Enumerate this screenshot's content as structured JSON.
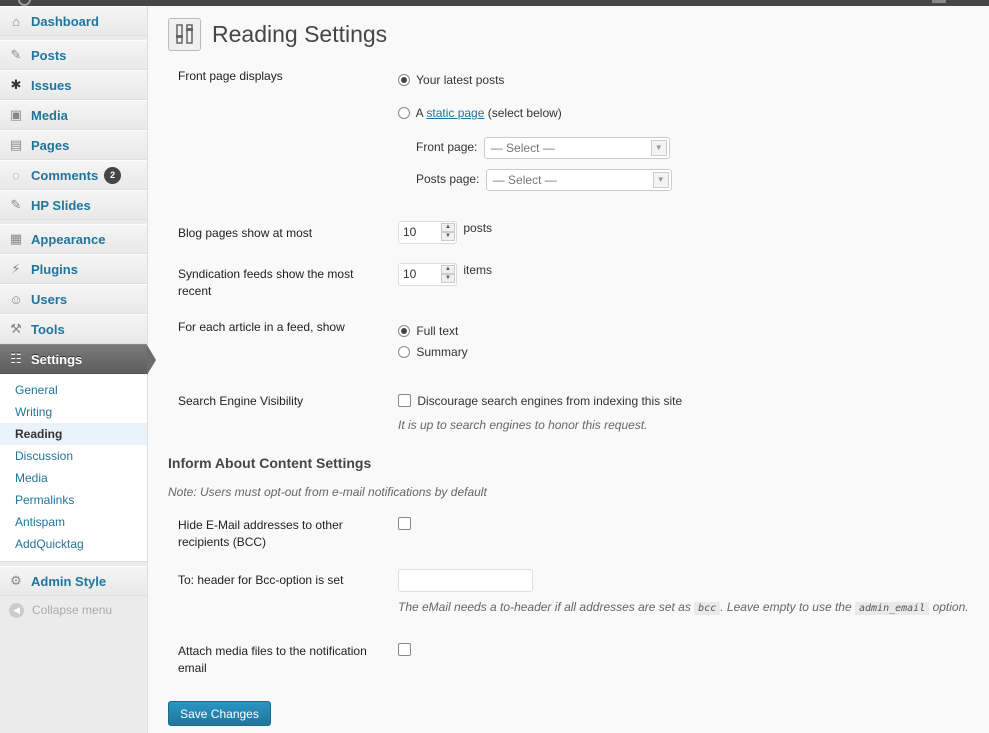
{
  "sidebar": {
    "items": [
      {
        "label": "Dashboard",
        "icon": "dashboard-icon"
      },
      {
        "label": "Posts",
        "icon": "pushpin-icon"
      },
      {
        "label": "Issues",
        "icon": "bug-icon"
      },
      {
        "label": "Media",
        "icon": "media-icon"
      },
      {
        "label": "Pages",
        "icon": "pages-icon"
      },
      {
        "label": "Comments",
        "icon": "comment-bubble-icon",
        "badge": "2"
      },
      {
        "label": "HP Slides",
        "icon": "pushpin-icon"
      },
      {
        "label": "Appearance",
        "icon": "appearance-icon"
      },
      {
        "label": "Plugins",
        "icon": "plug-icon"
      },
      {
        "label": "Users",
        "icon": "users-icon"
      },
      {
        "label": "Tools",
        "icon": "tools-icon"
      },
      {
        "label": "Settings",
        "icon": "settings-icon"
      }
    ],
    "settings_sub": [
      "General",
      "Writing",
      "Reading",
      "Discussion",
      "Media",
      "Permalinks",
      "Antispam",
      "AddQuicktag"
    ],
    "admin_style": "Admin Style",
    "collapse": "Collapse menu"
  },
  "page": {
    "title": "Reading Settings",
    "front_page": {
      "label": "Front page displays",
      "opt_latest": "Your latest posts",
      "opt_static_prefix": "A",
      "opt_static_link": "static page",
      "opt_static_suffix": "(select below)",
      "front_label": "Front page:",
      "front_value": "— Select —",
      "posts_label": "Posts page:",
      "posts_value": "— Select —"
    },
    "blog_pages": {
      "label": "Blog pages show at most",
      "value": "10",
      "unit": "posts"
    },
    "feeds": {
      "label": "Syndication feeds show the most recent",
      "value": "10",
      "unit": "items"
    },
    "feed_article": {
      "label": "For each article in a feed, show",
      "opt_full": "Full text",
      "opt_summary": "Summary"
    },
    "seo": {
      "label": "Search Engine Visibility",
      "checkbox": "Discourage search engines from indexing this site",
      "desc": "It is up to search engines to honor this request."
    },
    "inform": {
      "heading": "Inform About Content Settings",
      "note": "Note: Users must opt-out from e-mail notifications by default",
      "hide_label": "Hide E-Mail addresses to other recipients (BCC)",
      "to_label": "To: header for Bcc-option is set",
      "to_desc_1": "The eMail needs a to-header if all addresses are set as",
      "to_code_1": "bcc",
      "to_desc_2": ". Leave empty to use the",
      "to_code_2": "admin_email",
      "to_desc_3": "option.",
      "attach_label": "Attach media files to the notification email"
    },
    "save": "Save Changes"
  },
  "colors": {
    "link": "#21759b",
    "active_menu": "#6b6b6b",
    "button": "#21759b"
  }
}
